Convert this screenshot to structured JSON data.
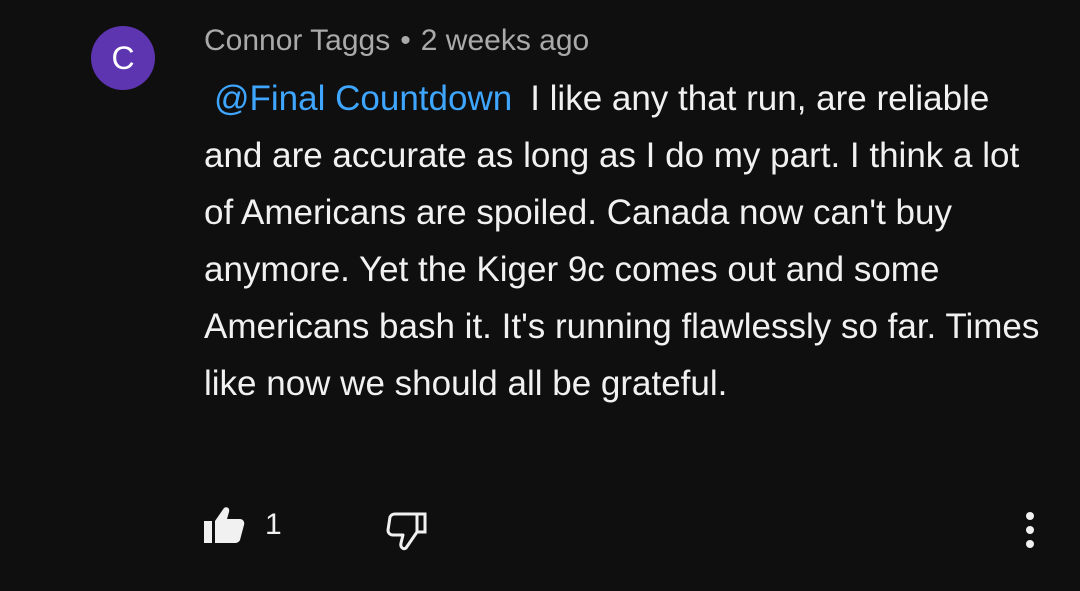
{
  "comment": {
    "avatar_letter": "C",
    "avatar_color": "#5e35b1",
    "author": "Connor Taggs",
    "separator": "•",
    "time": "2 weeks ago",
    "mention": "@Final Countdown",
    "text": "I like any that run, are reliable and are accurate as long as I do my part. I think a lot of Americans are spoiled. Canada now can't buy anymore. Yet the Kiger 9c comes out and some Americans bash it. It's running flawlessly so far. Times like now we should all be grateful."
  },
  "actions": {
    "like_icon": "thumbs-up-filled-icon",
    "like_count": "1",
    "dislike_icon": "thumbs-down-outline-icon",
    "more_icon": "more-vert-icon"
  },
  "colors": {
    "background": "#0f0f0f",
    "text": "#f1f1f1",
    "meta": "#aaaaaa",
    "link": "#3ea6ff"
  }
}
